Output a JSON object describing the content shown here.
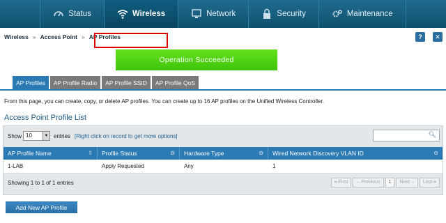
{
  "nav": {
    "items": [
      {
        "label": "Status",
        "icon": "speedometer-icon"
      },
      {
        "label": "Wireless",
        "icon": "wifi-icon"
      },
      {
        "label": "Network",
        "icon": "monitor-icon"
      },
      {
        "label": "Security",
        "icon": "lock-icon"
      },
      {
        "label": "Maintenance",
        "icon": "gears-icon"
      }
    ],
    "active": "Wireless"
  },
  "breadcrumb": [
    "Wireless",
    "Access Point",
    "AP Profiles"
  ],
  "breadcrumb_sep": "»",
  "help_icon": "?",
  "close_icon": "✕",
  "banner": {
    "text": "Operation Succeeded",
    "color": "#4fd214"
  },
  "tabs": [
    "AP Profiles",
    "AP Profile Radio",
    "AP Profile SSID",
    "AP Profile QoS"
  ],
  "description": "From this page, you can create, copy, or delete AP profiles. You can create up to 16 AP profiles on the Unified Wireless Controller.",
  "list_title": "Access Point Profile List",
  "toolbar": {
    "show_label": "Show",
    "page_size": "10",
    "entries_label": "entries",
    "hint": "[Right click on record to get more options]",
    "search_placeholder": ""
  },
  "table": {
    "columns": [
      "AP Profile Name",
      "Profile Status",
      "Hardware Type",
      "Wired Network Discovery VLAN ID"
    ],
    "rows": [
      [
        "1-LAB",
        "Apply Requested",
        "Any",
        "1"
      ]
    ]
  },
  "footer": {
    "info": "Showing 1 to 1 of 1 entries",
    "pager": [
      "First",
      "Previous",
      "1",
      "Next",
      "Last"
    ]
  },
  "add_button": "Add New AP Profile",
  "colors": {
    "accent": "#2b7ab3",
    "nav": "#1a6384",
    "highlight": "#e00000"
  }
}
